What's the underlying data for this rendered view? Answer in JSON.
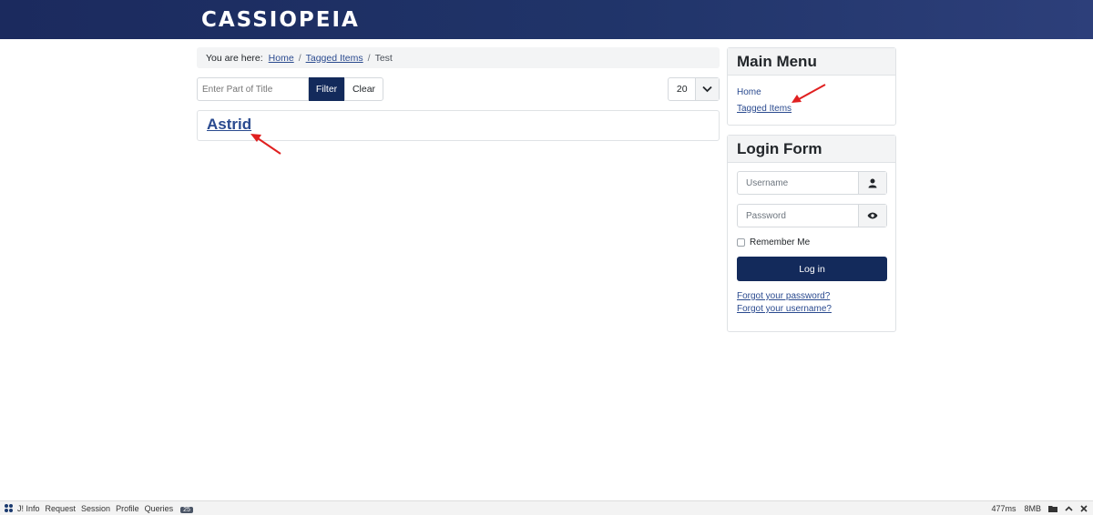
{
  "header": {
    "brand": "CASSIOPEIA"
  },
  "breadcrumb": {
    "prefix": "You are here:",
    "items": [
      "Home",
      "Tagged Items"
    ],
    "current": "Test"
  },
  "filter": {
    "placeholder": "Enter Part of Title",
    "filter_label": "Filter",
    "clear_label": "Clear",
    "limit_value": "20"
  },
  "results": [
    {
      "title": "Astrid"
    }
  ],
  "main_menu": {
    "title": "Main Menu",
    "items": [
      "Home",
      "Tagged Items"
    ]
  },
  "login_form": {
    "title": "Login Form",
    "username_placeholder": "Username",
    "password_placeholder": "Password",
    "remember_label": "Remember Me",
    "login_label": "Log in",
    "forgot_password": "Forgot your password?",
    "forgot_username": "Forgot your username?"
  },
  "debug_bar": {
    "items": [
      "J! Info",
      "Request",
      "Session",
      "Profile",
      "Queries"
    ],
    "queries_count": "25",
    "time": "477ms",
    "memory": "8MB"
  },
  "colors": {
    "header": "#1b2a5e",
    "primary_button": "#132a5b",
    "link": "#2a4a8f",
    "annotation": "#e02020"
  },
  "icons": [
    "user-icon",
    "eye-icon",
    "chevron-down-icon",
    "joomla-icon",
    "folder-icon",
    "chevron-up-icon",
    "close-icon"
  ]
}
